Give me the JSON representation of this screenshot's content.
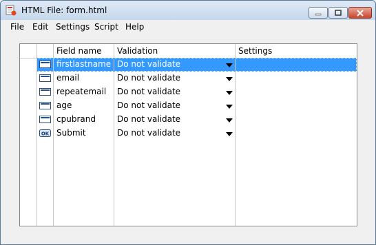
{
  "window": {
    "title": "HTML File: form.html"
  },
  "menu": [
    "File",
    "Edit",
    "Settings",
    "Script",
    "Help"
  ],
  "grid": {
    "columns": [
      "",
      "Field name",
      "Validation",
      "Settings"
    ],
    "rows": [
      {
        "icon": "textbox-icon",
        "name": "firstlastname",
        "validation": "Do not validate",
        "settings": "",
        "selected": true
      },
      {
        "icon": "textbox-icon",
        "name": "email",
        "validation": "Do not validate",
        "settings": ""
      },
      {
        "icon": "textbox-icon",
        "name": "repeatemail",
        "validation": "Do not validate",
        "settings": ""
      },
      {
        "icon": "textbox-icon",
        "name": "age",
        "validation": "Do not validate",
        "settings": ""
      },
      {
        "icon": "textbox-icon",
        "name": "cpubrand",
        "validation": "Do not validate",
        "settings": ""
      },
      {
        "icon": "ok-button-icon",
        "name": "Submit",
        "validation": "Do not validate",
        "settings": ""
      }
    ]
  },
  "colors": {
    "selection": "#3399ff",
    "close": "#c9432d"
  }
}
